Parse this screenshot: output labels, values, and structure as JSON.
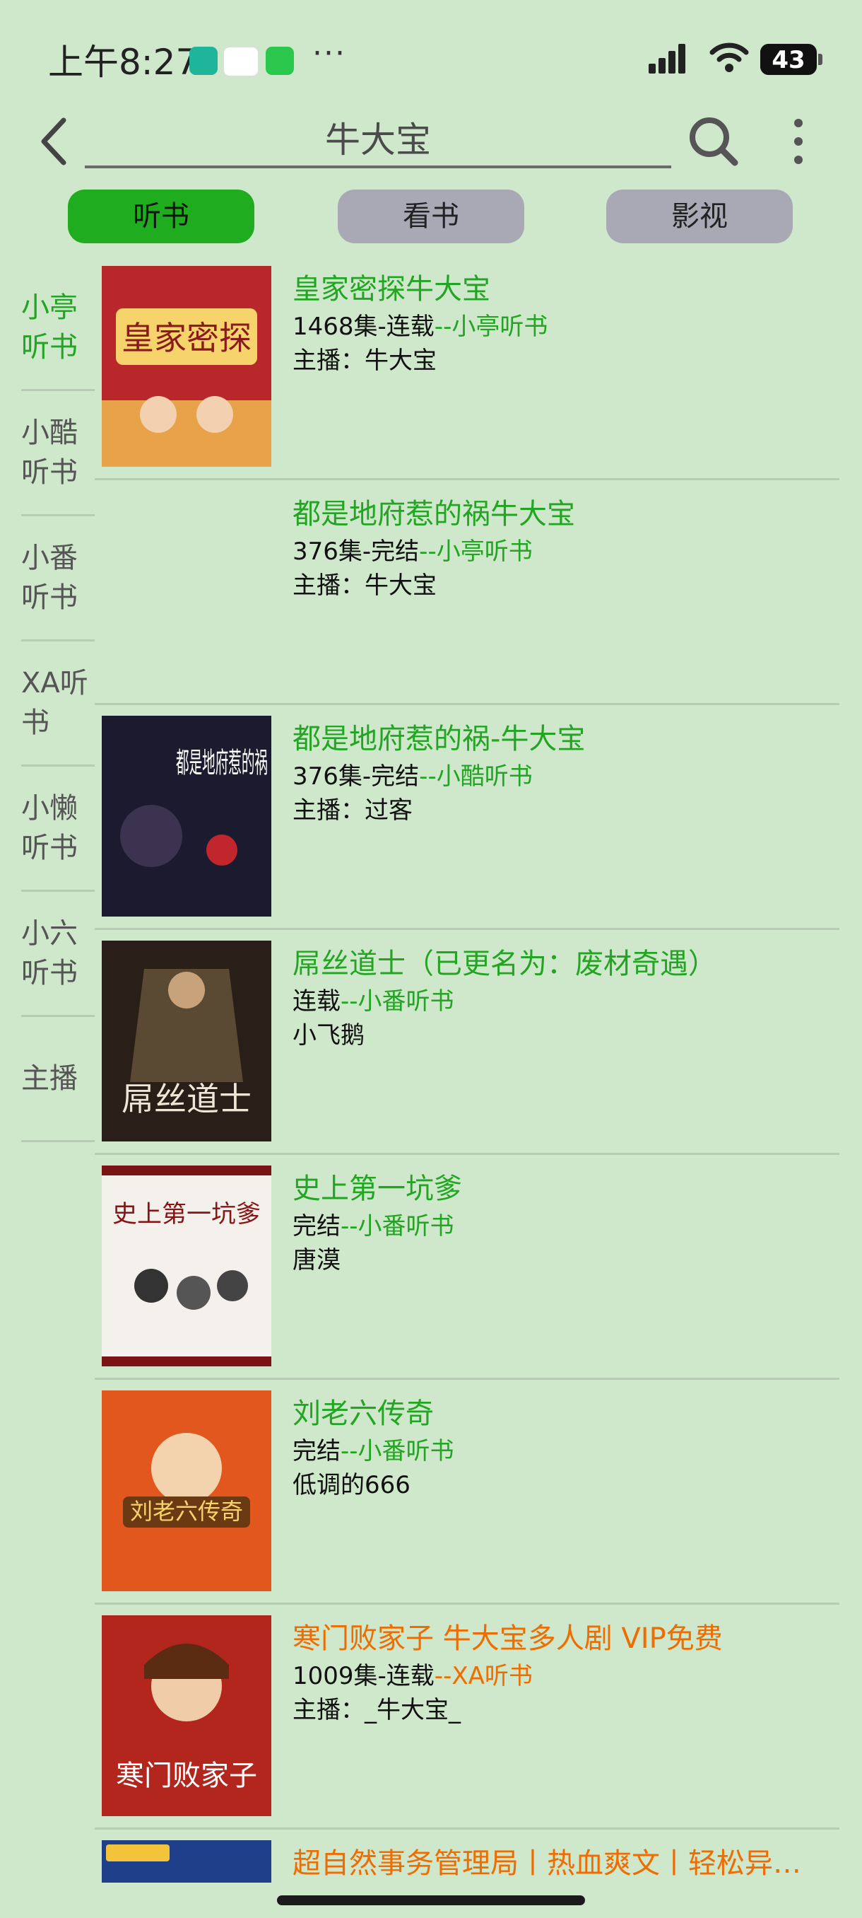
{
  "status_bar": {
    "time": "上午8:27",
    "ellipsis": "···",
    "battery": "43"
  },
  "search": {
    "query": "牛大宝"
  },
  "tabs": [
    {
      "label": "听书",
      "active": true
    },
    {
      "label": "看书",
      "active": false
    },
    {
      "label": "影视",
      "active": false
    }
  ],
  "sources": [
    {
      "label": "小亭听书",
      "active": true
    },
    {
      "label": "小酷听书",
      "active": false
    },
    {
      "label": "小番听书",
      "active": false
    },
    {
      "label": "XA听书",
      "active": false
    },
    {
      "label": "小懒听书",
      "active": false
    },
    {
      "label": "小六听书",
      "active": false
    },
    {
      "label": "主播",
      "active": false
    }
  ],
  "results": [
    {
      "title": "皇家密探牛大宝",
      "status": "1468集-连载",
      "source": "--小亭听书",
      "author": "主播：牛大宝",
      "cover_text": "皇家密探"
    },
    {
      "title": "都是地府惹的祸牛大宝",
      "status": "376集-完结",
      "source": "--小亭听书",
      "author": "主播：牛大宝"
    },
    {
      "title": "都是地府惹的祸-牛大宝",
      "status": "376集-完结",
      "source": "--小酷听书",
      "author": "主播：过客",
      "cover_text": "都是地府惹的祸"
    },
    {
      "title": "屌丝道士（已更名为：废材奇遇）",
      "status": "连载",
      "source": "--小番听书",
      "author": "小飞鹅",
      "cover_text": "屌丝道士"
    },
    {
      "title": "史上第一坑爹",
      "status": "完结",
      "source": "--小番听书",
      "author": "唐漠",
      "cover_text": "史上第一坑爹"
    },
    {
      "title": "刘老六传奇",
      "status": "完结",
      "source": "--小番听书",
      "author": "低调的666",
      "cover_text": "刘老六传奇"
    },
    {
      "title": "寒门败家子 牛大宝多人剧 VIP免费",
      "status": "1009集-连载",
      "source": "--XA听书",
      "author": "主播：_牛大宝_",
      "cover_text": "寒门败家子"
    },
    {
      "title": "超自然事务管理局丨热血爽文丨轻松异…",
      "status": "",
      "source": "",
      "author": ""
    }
  ],
  "colors": {
    "background": "#cfe8cb",
    "accent_green": "#22a522",
    "accent_orange": "#ef6c00",
    "tab_inactive": "#a9a9b6"
  }
}
